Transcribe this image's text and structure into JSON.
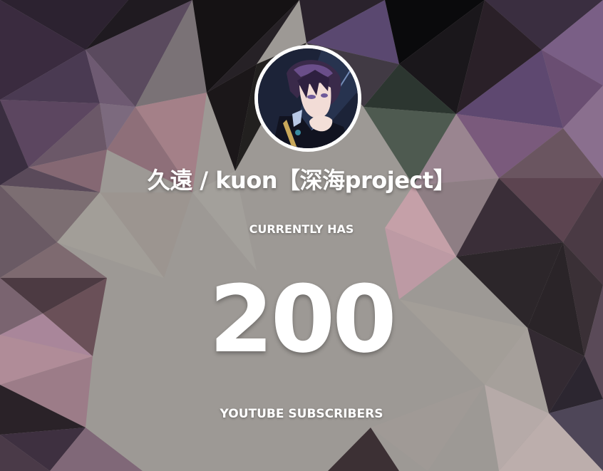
{
  "channel": {
    "name": "久遠 / kuon【深海project】",
    "avatar_icon": "channel-avatar-anime-character"
  },
  "counter": {
    "prefix_label": "CURRENTLY HAS",
    "value": "200",
    "suffix_label": "YOUTUBE SUBSCRIBERS"
  },
  "colors": {
    "text": "#ffffff",
    "bg_dark": "#1a1518",
    "bg_purple": "#6d4a72",
    "bg_gray": "#9e9a96",
    "bg_mauve": "#a07a84"
  }
}
